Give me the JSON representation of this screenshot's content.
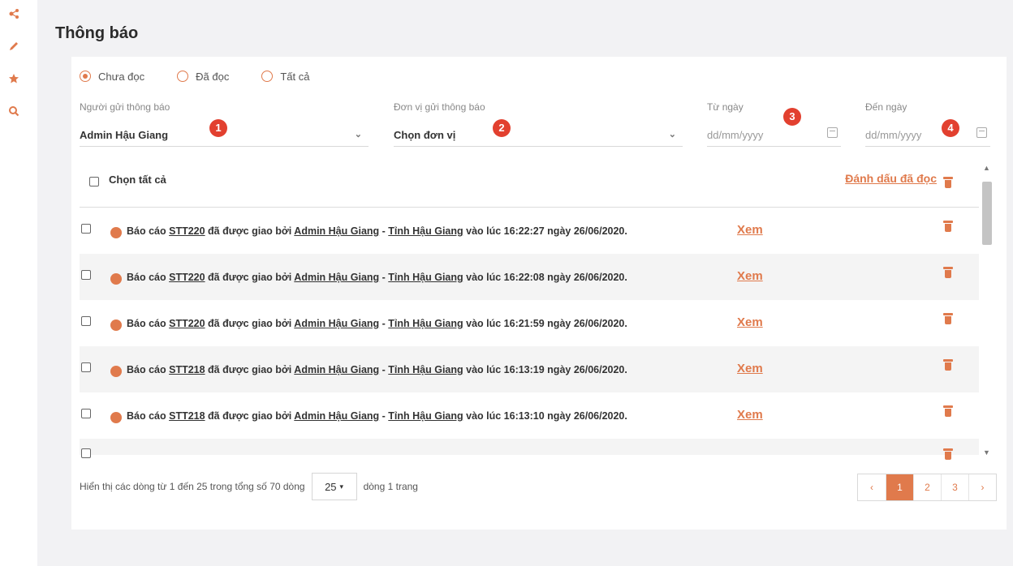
{
  "rail": {
    "icons": [
      "share-icon",
      "pencil-icon",
      "star-icon",
      "search-icon"
    ]
  },
  "page": {
    "title": "Thông báo"
  },
  "filters": {
    "radios": [
      "Chưa đọc",
      "Đã đọc",
      "Tất cả"
    ],
    "selected_radio": "Chưa đọc",
    "sender": {
      "label": "Người gửi thông báo",
      "value": "Admin Hậu Giang",
      "badge": "1"
    },
    "unit": {
      "label": "Đơn vị gửi thông báo",
      "value": "Chọn đơn vị",
      "badge": "2"
    },
    "from_date": {
      "label": "Từ ngày",
      "placeholder": "dd/mm/yyyy",
      "badge": "3"
    },
    "to_date": {
      "label": "Đến ngày",
      "placeholder": "dd/mm/yyyy",
      "badge": "4"
    }
  },
  "list": {
    "select_all_label": "Chọn tất cả",
    "mark_read_label": "Đánh dấu đã đọc",
    "rows": [
      {
        "prefix": "Báo cáo ",
        "report": "STT220",
        "mid": " đã được giao bởi ",
        "sender": "Admin Hậu Giang",
        "sep": " - ",
        "province": "Tỉnh Hậu Giang",
        "suffix": " vào lúc 16:22:27 ngày 26/06/2020.",
        "link": "Xem"
      },
      {
        "prefix": "Báo cáo ",
        "report": "STT220",
        "mid": " đã được giao bởi ",
        "sender": "Admin Hậu Giang",
        "sep": " - ",
        "province": "Tỉnh Hậu Giang",
        "suffix": " vào lúc 16:22:08 ngày 26/06/2020.",
        "link": "Xem"
      },
      {
        "prefix": "Báo cáo ",
        "report": "STT220",
        "mid": " đã được giao bởi ",
        "sender": "Admin Hậu Giang",
        "sep": " - ",
        "province": "Tỉnh Hậu Giang",
        "suffix": " vào lúc 16:21:59 ngày 26/06/2020.",
        "link": "Xem"
      },
      {
        "prefix": "Báo cáo ",
        "report": "STT218",
        "mid": " đã được giao bởi ",
        "sender": "Admin Hậu Giang",
        "sep": " - ",
        "province": "Tỉnh Hậu Giang",
        "suffix": " vào lúc 16:13:19 ngày 26/06/2020.",
        "link": "Xem"
      },
      {
        "prefix": "Báo cáo ",
        "report": "STT218",
        "mid": " đã được giao bởi ",
        "sender": "Admin Hậu Giang",
        "sep": " - ",
        "province": "Tỉnh Hậu Giang",
        "suffix": " vào lúc 16:13:10 ngày 26/06/2020.",
        "link": "Xem"
      }
    ]
  },
  "footer": {
    "summary": "Hiển thị các dòng từ 1 đến 25 trong tổng số 70 dòng",
    "page_size": "25",
    "per_page_label": "dòng 1 trang",
    "pages": [
      "‹",
      "1",
      "2",
      "3",
      "›"
    ],
    "active_page": "1"
  },
  "colors": {
    "accent": "#e07a4c",
    "badge": "#e2402f",
    "background": "#f2f2f4"
  }
}
